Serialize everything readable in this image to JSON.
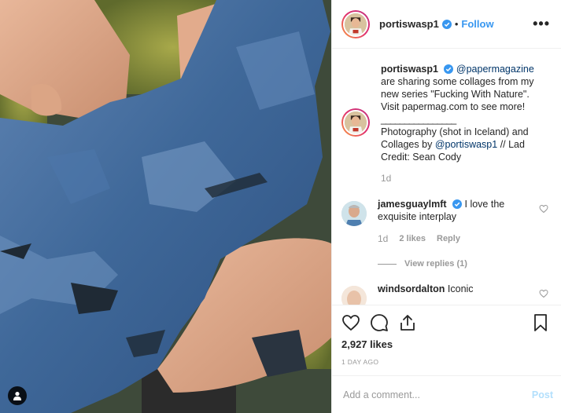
{
  "post": {
    "username": "portiswasp1",
    "follow_label": "Follow",
    "separator": "•",
    "more_label": "•••",
    "tag_icon": "user-tag-icon"
  },
  "caption": {
    "username": "portiswasp1",
    "mention": "@papermagazine",
    "text_1": "are sharing some collages from my new series \"Fucking With Nature\". Visit papermag.com to see more!",
    "rule": "________________",
    "text_2": "Photography (shot in Iceland) and Collages by",
    "mention_2": "@portiswasp1",
    "text_3": "// Lad Credit: Sean Cody",
    "time": "1d"
  },
  "comments": [
    {
      "username": "jamesguaylmft",
      "text": "I love the exquisite interplay",
      "time": "1d",
      "likes": "2 likes",
      "reply_label": "Reply",
      "view_replies": "View replies (1)"
    },
    {
      "username": "windsordalton",
      "text": "Iconic"
    }
  ],
  "actions": {
    "likes": "2,927 likes",
    "date": "1 DAY AGO"
  },
  "add_comment": {
    "placeholder": "Add a comment...",
    "post_label": "Post"
  },
  "colors": {
    "link": "#3897f0",
    "mention": "#003569",
    "muted": "#999999",
    "post_disabled": "#b2dffc"
  }
}
